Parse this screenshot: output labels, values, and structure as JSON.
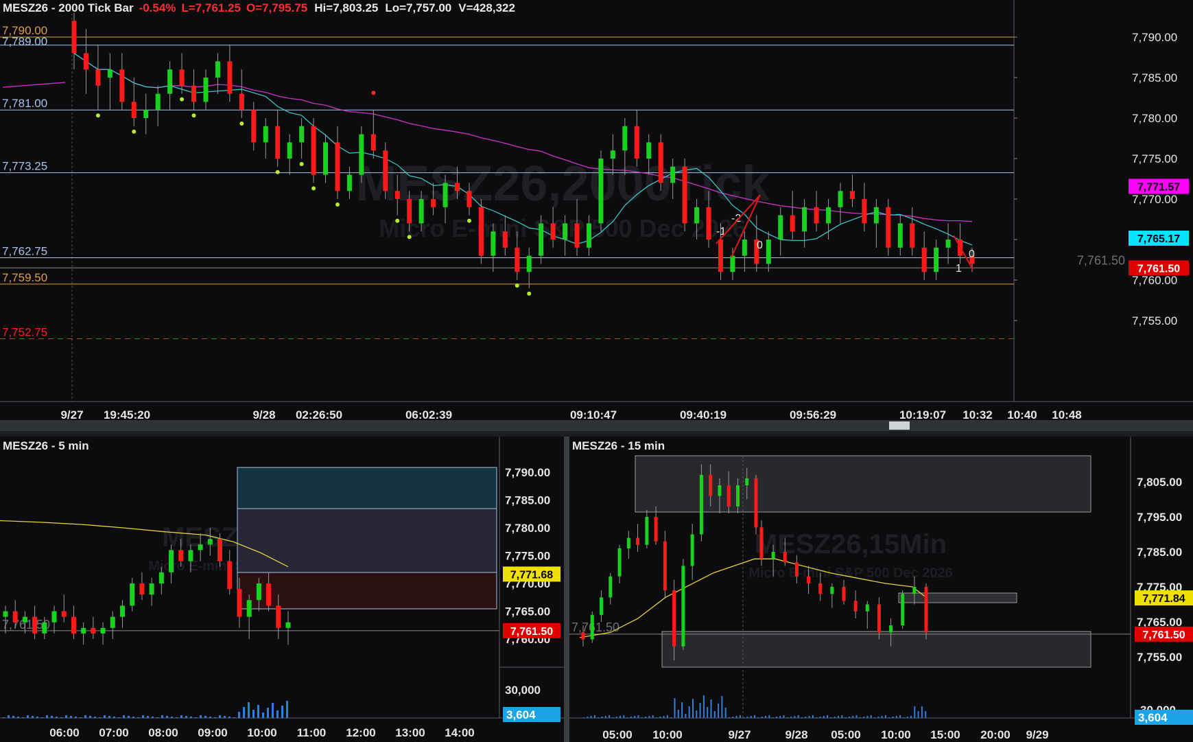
{
  "top_chart": {
    "title": "MESZ26 - 2000 Tick Bar",
    "change": "-0.54%",
    "last": "L=7,761.25",
    "open": "O=7,795.75",
    "high": "Hi=7,803.25",
    "low": "Lo=7,757.00",
    "volume": "V=428,322",
    "watermark": "MESZ26,2000Tick",
    "watermark_sub": "Micro E-mini S&P 500 Dec 2026",
    "y_ticks": [
      "7,790.00",
      "7,785.00",
      "7,780.00",
      "7,775.00",
      "7,770.00",
      "7,765.00",
      "7,760.00",
      "7,755.00"
    ],
    "x_labels": [
      "9/27",
      "19:45:20",
      "9/28",
      "02:26:50",
      "06:02:39",
      "09:10:47",
      "09:40:19",
      "09:56:29",
      "10:19:07",
      "10:32",
      "10:40",
      "10:48"
    ],
    "levels": [
      {
        "label": "7,790.00",
        "color": "#e0a040"
      },
      {
        "label": "7,789.00",
        "color": "#a8c4e8"
      },
      {
        "label": "7,781.00",
        "color": "#a8c4e8"
      },
      {
        "label": "7,773.25",
        "color": "#a8c4e8"
      },
      {
        "label": "7,762.75",
        "color": "#a8c4e8"
      },
      {
        "label": "7,759.50",
        "color": "#e0a040"
      },
      {
        "label": "7,752.75",
        "color": "#ff2020"
      }
    ],
    "price_tags": [
      {
        "label": "7,771.57",
        "color": "#ff00ff",
        "text_color": "#000000"
      },
      {
        "label": "7,765.17",
        "color": "#00e5ff",
        "text_color": "#000000"
      },
      {
        "label": "7,761.50",
        "color": "#e00000",
        "text_color": "#ffffff"
      }
    ],
    "last_price_line_label": "7,761.50",
    "wave_labels": [
      "-1",
      "-2",
      "0",
      "0",
      "1"
    ]
  },
  "five_min_chart": {
    "title": "MESZ26 - 5 min",
    "watermark": "MESZ26,5Min",
    "watermark_sub": "Micro E-mini S&P 500 Dec 2026",
    "y_ticks": [
      "7,790.00",
      "7,785.00",
      "7,780.00",
      "7,775.00",
      "7,770.00",
      "7,765.00",
      "7,760.00"
    ],
    "volume_tick": "30,000",
    "volume_tag": "3,604",
    "price_tags": [
      {
        "label": "7,771.68",
        "color": "#f0e000",
        "text_color": "#000000"
      },
      {
        "label": "7,761.50",
        "color": "#e00000",
        "text_color": "#ffffff"
      }
    ],
    "last_price_line_label": "7,761.50",
    "x_labels": [
      "06:00",
      "07:00",
      "08:00",
      "09:00",
      "10:00",
      "11:00",
      "12:00",
      "13:00",
      "14:00"
    ]
  },
  "fifteen_min_chart": {
    "title": "MESZ26 - 15 min",
    "watermark": "MESZ26,15Min",
    "watermark_sub": "Micro E-mini S&P 500 Dec 2026",
    "y_ticks": [
      "7,805.00",
      "7,795.00",
      "7,785.00",
      "7,775.00",
      "7,765.00",
      "7,755.00"
    ],
    "volume_tick": "30,000",
    "volume_tag": "3,604",
    "price_tags": [
      {
        "label": "7,771.84",
        "color": "#f0e000",
        "text_color": "#000000"
      },
      {
        "label": "7,761.50",
        "color": "#e00000",
        "text_color": "#ffffff"
      }
    ],
    "last_price_line_label": "7,761.50",
    "x_labels": [
      "05:00",
      "10:00",
      "9/27",
      "9/28",
      "05:00",
      "10:00",
      "15:00",
      "20:00",
      "9/29"
    ]
  },
  "chart_data": [
    {
      "type": "candlestick",
      "title": "MESZ26 - 2000 Tick Bar",
      "ylim": [
        7750.5,
        7794.5
      ],
      "indicators": [
        "fast moving average (cyan)",
        "slow moving average (magenta)"
      ],
      "horizontal_levels": [
        7790.0,
        7789.0,
        7781.0,
        7773.25,
        7762.75,
        7759.5,
        7752.75
      ],
      "last_price": 7761.5,
      "candles": [
        [
          7792,
          7793,
          7786,
          7788
        ],
        [
          7788,
          7791,
          7783,
          7786
        ],
        [
          7786,
          7789,
          7781,
          7784
        ],
        [
          7785,
          7788,
          7781,
          7786
        ],
        [
          7786,
          7788,
          7781,
          7782
        ],
        [
          7782,
          7785,
          7779,
          7780
        ],
        [
          7780,
          7783,
          7778,
          7781
        ],
        [
          7781,
          7784,
          7779,
          7783
        ],
        [
          7783,
          7787,
          7781,
          7786
        ],
        [
          7786,
          7788,
          7783,
          7784
        ],
        [
          7784,
          7786,
          7781,
          7782
        ],
        [
          7782,
          7786,
          7781,
          7785
        ],
        [
          7785,
          7788,
          7783,
          7787
        ],
        [
          7787,
          7789,
          7782,
          7783
        ],
        [
          7783,
          7786,
          7780,
          7781
        ],
        [
          7781,
          7782,
          7776,
          7777
        ],
        [
          7777,
          7780,
          7775,
          7779
        ],
        [
          7779,
          7781,
          7774,
          7775
        ],
        [
          7775,
          7778,
          7773,
          7777
        ],
        [
          7777,
          7780,
          7775,
          7779
        ],
        [
          7779,
          7780,
          7772,
          7773
        ],
        [
          7773,
          7778,
          7772,
          7777
        ],
        [
          7777,
          7779,
          7770,
          7771
        ],
        [
          7771,
          7774,
          7770,
          7773
        ],
        [
          7773,
          7779,
          7772,
          7778
        ],
        [
          7778,
          7781,
          7775,
          7776
        ],
        [
          7776,
          7777,
          7770,
          7771
        ],
        [
          7771,
          7773,
          7768,
          7770
        ],
        [
          7770,
          7771,
          7766,
          7767
        ],
        [
          7767,
          7771,
          7766,
          7770
        ],
        [
          7770,
          7772,
          7768,
          7769
        ],
        [
          7769,
          7773,
          7767,
          7772
        ],
        [
          7772,
          7774,
          7770,
          7771
        ],
        [
          7771,
          7772,
          7768,
          7769
        ],
        [
          7769,
          7770,
          7762,
          7763
        ],
        [
          7763,
          7767,
          7761,
          7766
        ],
        [
          7766,
          7768,
          7763,
          7764
        ],
        [
          7764,
          7766,
          7760,
          7761
        ],
        [
          7761,
          7764,
          7759,
          7763
        ],
        [
          7763,
          7768,
          7762,
          7767
        ],
        [
          7767,
          7769,
          7764,
          7765
        ],
        [
          7765,
          7768,
          7763,
          7767
        ],
        [
          7767,
          7770,
          7763,
          7764
        ],
        [
          7764,
          7768,
          7763,
          7767
        ],
        [
          7767,
          7776,
          7766,
          7775
        ],
        [
          7775,
          7778,
          7773,
          7776
        ],
        [
          7776,
          7780,
          7773,
          7779
        ],
        [
          7779,
          7781,
          7774,
          7775
        ],
        [
          7775,
          7778,
          7773,
          7777
        ],
        [
          7777,
          7778,
          7771,
          7772
        ],
        [
          7772,
          7775,
          7770,
          7774
        ],
        [
          7774,
          7775,
          7766,
          7767
        ],
        [
          7767,
          7770,
          7765,
          7769
        ],
        [
          7769,
          7771,
          7764,
          7765
        ],
        [
          7765,
          7767,
          7760,
          7761
        ],
        [
          7761,
          7764,
          7760,
          7763
        ],
        [
          7763,
          7766,
          7761,
          7765
        ],
        [
          7765,
          7768,
          7761,
          7762
        ],
        [
          7762,
          7766,
          7761,
          7765
        ],
        [
          7765,
          7769,
          7763,
          7768
        ],
        [
          7768,
          7771,
          7765,
          7766
        ],
        [
          7766,
          7770,
          7764,
          7769
        ],
        [
          7769,
          7771,
          7766,
          7767
        ],
        [
          7767,
          7770,
          7765,
          7769
        ],
        [
          7769,
          7772,
          7767,
          7771
        ],
        [
          7771,
          7773,
          7769,
          7770
        ],
        [
          7770,
          7772,
          7766,
          7767
        ],
        [
          7767,
          7770,
          7764,
          7769
        ],
        [
          7769,
          7770,
          7763,
          7764
        ],
        [
          7764,
          7768,
          7763,
          7767
        ],
        [
          7767,
          7769,
          7763,
          7764
        ],
        [
          7764,
          7766,
          7760,
          7761
        ],
        [
          7761,
          7765,
          7760,
          7764
        ],
        [
          7764,
          7767,
          7762,
          7765
        ],
        [
          7765,
          7767,
          7762,
          7763
        ],
        [
          7763,
          7764,
          7761,
          7762
        ]
      ]
    },
    {
      "type": "candlestick",
      "title": "MESZ26 - 5 min",
      "ylim": [
        7756,
        7793
      ],
      "indicators": [
        "moving average (yellow)"
      ],
      "volume_bars": true,
      "last_price": 7761.5,
      "candles": [
        [
          7764,
          7766,
          7761,
          7765
        ],
        [
          7765,
          7767,
          7762,
          7763
        ],
        [
          7763,
          7765,
          7761,
          7764
        ],
        [
          7764,
          7766,
          7760,
          7761
        ],
        [
          7761,
          7764,
          7760,
          7763
        ],
        [
          7763,
          7766,
          7761,
          7765
        ],
        [
          7765,
          7768,
          7763,
          7764
        ],
        [
          7764,
          7766,
          7760,
          7761
        ],
        [
          7761,
          7763,
          7759,
          7762
        ],
        [
          7762,
          7764,
          7760,
          7761
        ],
        [
          7761,
          7763,
          7759,
          7762
        ],
        [
          7762,
          7765,
          7760,
          7764
        ],
        [
          7764,
          7767,
          7762,
          7766
        ],
        [
          7766,
          7771,
          7765,
          7770
        ],
        [
          7770,
          7772,
          7767,
          7768
        ],
        [
          7768,
          7771,
          7766,
          7770
        ],
        [
          7770,
          7773,
          7768,
          7772
        ],
        [
          7772,
          7777,
          7770,
          7776
        ],
        [
          7776,
          7778,
          7773,
          7774
        ],
        [
          7774,
          7777,
          7772,
          7776
        ],
        [
          7776,
          7779,
          7774,
          7777
        ],
        [
          7777,
          7780,
          7775,
          7778
        ],
        [
          7778,
          7779,
          7773,
          7774
        ],
        [
          7774,
          7776,
          7768,
          7769
        ],
        [
          7769,
          7771,
          7762,
          7764
        ],
        [
          7764,
          7768,
          7760,
          7767
        ],
        [
          7767,
          7771,
          7765,
          7770
        ],
        [
          7770,
          7772,
          7765,
          7766
        ],
        [
          7766,
          7768,
          7760,
          7762
        ],
        [
          7762,
          7765,
          7759,
          7763
        ]
      ]
    },
    {
      "type": "candlestick",
      "title": "MESZ26 - 15 min",
      "ylim": [
        7751,
        7813
      ],
      "indicators": [
        "moving average (yellow)"
      ],
      "volume_bars": true,
      "last_price": 7761.5,
      "candles": [
        [
          7762,
          7764,
          7758,
          7760
        ],
        [
          7760,
          7768,
          7759,
          7767
        ],
        [
          7767,
          7774,
          7765,
          7772
        ],
        [
          7772,
          7779,
          7770,
          7778
        ],
        [
          7778,
          7787,
          7776,
          7786
        ],
        [
          7786,
          7791,
          7783,
          7789
        ],
        [
          7789,
          7793,
          7785,
          7787
        ],
        [
          7787,
          7797,
          7786,
          7795
        ],
        [
          7795,
          7798,
          7787,
          7788
        ],
        [
          7788,
          7791,
          7772,
          7774
        ],
        [
          7774,
          7777,
          7754,
          7758
        ],
        [
          7758,
          7783,
          7757,
          7781
        ],
        [
          7781,
          7793,
          7777,
          7790
        ],
        [
          7790,
          7810,
          7788,
          7807
        ],
        [
          7807,
          7810,
          7798,
          7801
        ],
        [
          7801,
          7806,
          7796,
          7804
        ],
        [
          7804,
          7808,
          7796,
          7798
        ],
        [
          7798,
          7806,
          7796,
          7804
        ],
        [
          7804,
          7809,
          7800,
          7806
        ],
        [
          7806,
          7807,
          7790,
          7792
        ],
        [
          7792,
          7794,
          7781,
          7783
        ],
        [
          7783,
          7787,
          7778,
          7785
        ],
        [
          7785,
          7789,
          7781,
          7782
        ],
        [
          7782,
          7784,
          7776,
          7778
        ],
        [
          7778,
          7781,
          7773,
          7776
        ],
        [
          7776,
          7779,
          7771,
          7773
        ],
        [
          7773,
          7776,
          7769,
          7775
        ],
        [
          7775,
          7777,
          7770,
          7771
        ],
        [
          7771,
          7774,
          7766,
          7768
        ],
        [
          7768,
          7771,
          7763,
          7770
        ],
        [
          7770,
          7772,
          7760,
          7762
        ],
        [
          7762,
          7766,
          7758,
          7764
        ],
        [
          7764,
          7774,
          7763,
          7773
        ],
        [
          7773,
          7778,
          7770,
          7775
        ],
        [
          7775,
          7776,
          7760,
          7762
        ]
      ]
    }
  ]
}
